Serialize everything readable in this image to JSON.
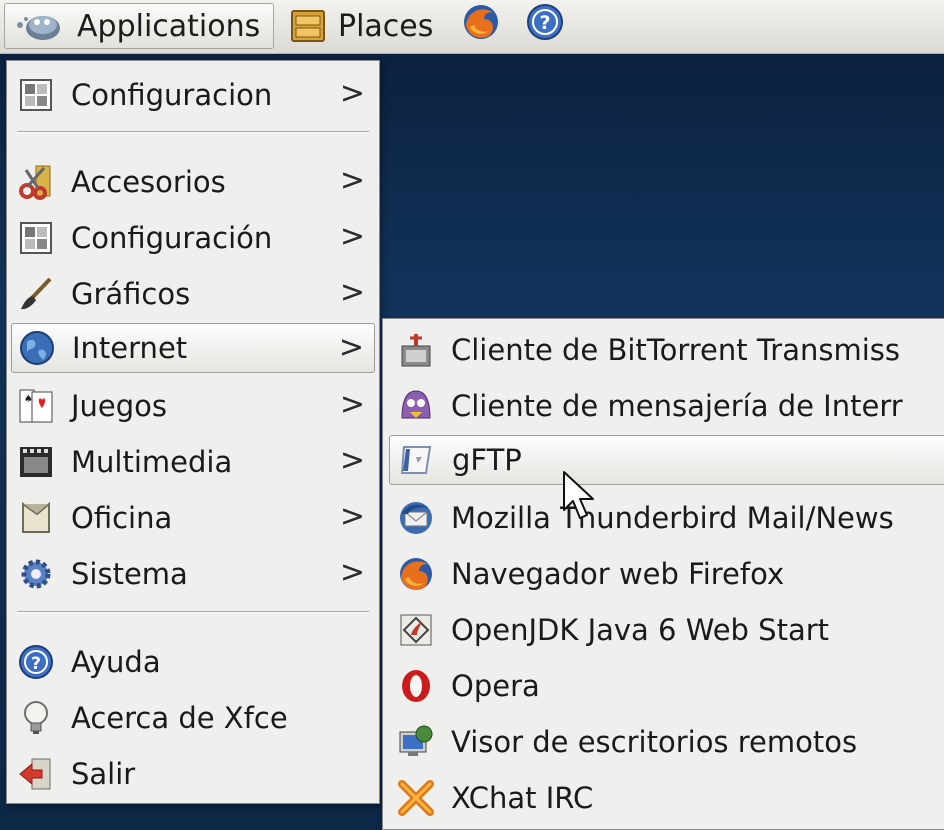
{
  "panel": {
    "applications_label": "Applications",
    "places_label": "Places"
  },
  "main_menu": {
    "items": [
      {
        "label": "Configuracion",
        "icon": "settings-panel-icon"
      },
      {
        "label": "Accesorios",
        "icon": "scissors-icon"
      },
      {
        "label": "Configuración",
        "icon": "settings-panel-icon"
      },
      {
        "label": "Gráficos",
        "icon": "paintbrush-icon"
      },
      {
        "label": "Internet",
        "icon": "globe-icon"
      },
      {
        "label": "Juegos",
        "icon": "playing-card-icon"
      },
      {
        "label": "Multimedia",
        "icon": "film-icon"
      },
      {
        "label": "Oficina",
        "icon": "document-icon"
      },
      {
        "label": "Sistema",
        "icon": "gear-icon"
      },
      {
        "label": "Ayuda",
        "icon": "help-icon"
      },
      {
        "label": "Acerca de Xfce",
        "icon": "lightbulb-icon"
      },
      {
        "label": "Salir",
        "icon": "exit-icon"
      }
    ],
    "submenu_arrow": ">"
  },
  "internet_submenu": {
    "items": [
      {
        "label": "Cliente de BitTorrent Transmiss",
        "icon": "transmission-icon"
      },
      {
        "label": "Cliente de mensajería de Interr",
        "icon": "pidgin-icon"
      },
      {
        "label": "gFTP",
        "icon": "gftp-icon"
      },
      {
        "label": "Mozilla Thunderbird Mail/News",
        "icon": "thunderbird-icon"
      },
      {
        "label": "Navegador web Firefox",
        "icon": "firefox-icon"
      },
      {
        "label": "OpenJDK Java 6 Web Start",
        "icon": "java-icon"
      },
      {
        "label": "Opera",
        "icon": "opera-icon"
      },
      {
        "label": "Visor de escritorios remotos",
        "icon": "remote-desktop-icon"
      },
      {
        "label": "XChat IRC",
        "icon": "xchat-icon"
      }
    ]
  },
  "highlighted": [
    "Internet",
    "gFTP"
  ]
}
